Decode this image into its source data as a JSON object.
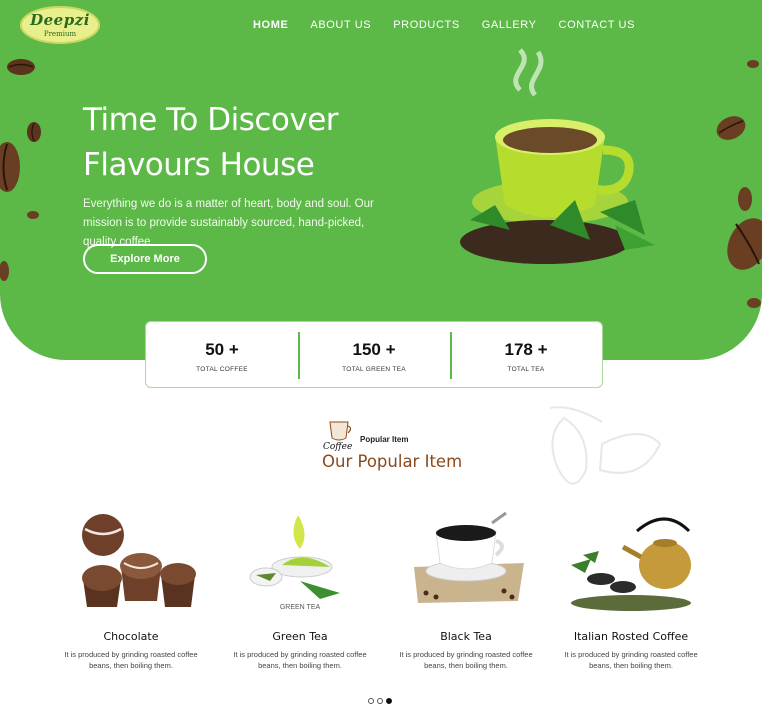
{
  "logo": {
    "brand": "Deepzi",
    "tier": "Premium"
  },
  "nav": [
    {
      "label": "HOME",
      "active": true
    },
    {
      "label": "ABOUT US",
      "active": false
    },
    {
      "label": "PRODUCTS",
      "active": false
    },
    {
      "label": "GALLERY",
      "active": false
    },
    {
      "label": "CONTACT US",
      "active": false
    }
  ],
  "hero": {
    "title_line1": "Time To Discover",
    "title_line2": "Flavours House",
    "subtitle": "Everything we do is a matter of heart, body and soul. Our mission is to provide sustainably sourced, hand-picked, quality coffee",
    "button": "Explore More"
  },
  "stats": [
    {
      "value": "50 +",
      "label": "TOTAL COFFEE"
    },
    {
      "value": "150 +",
      "label": "TOTAL GREEN TEA"
    },
    {
      "value": "178 +",
      "label": "TOTAL TEA"
    }
  ],
  "popular": {
    "tag": "Popular Item",
    "icon_text": "Coffee",
    "title": "Our Popular Item"
  },
  "items": [
    {
      "name": "Chocolate",
      "desc": "It is produced by grinding roasted coffee beans, then boiling them.",
      "pic_label": ""
    },
    {
      "name": "Green Tea",
      "desc": "It is produced by grinding roasted coffee beans, then boiling them.",
      "pic_label": "GREEN TEA"
    },
    {
      "name": "Black Tea",
      "desc": "It is produced by grinding roasted coffee beans, then boiling them.",
      "pic_label": ""
    },
    {
      "name": "Italian Rosted Coffee",
      "desc": "It is produced by grinding roasted coffee beans, then boiling them.",
      "pic_label": ""
    }
  ],
  "carousel": {
    "pages": 3,
    "active": 3
  },
  "colors": {
    "brand_green": "#5cb847",
    "title_brown": "#8a4a1c",
    "logo_bg": "#e8ef8c"
  },
  "icons": [
    "coffee-bean-icon",
    "tea-cup-icon",
    "coffee-cup-icon",
    "cocoa-pod-icon"
  ]
}
